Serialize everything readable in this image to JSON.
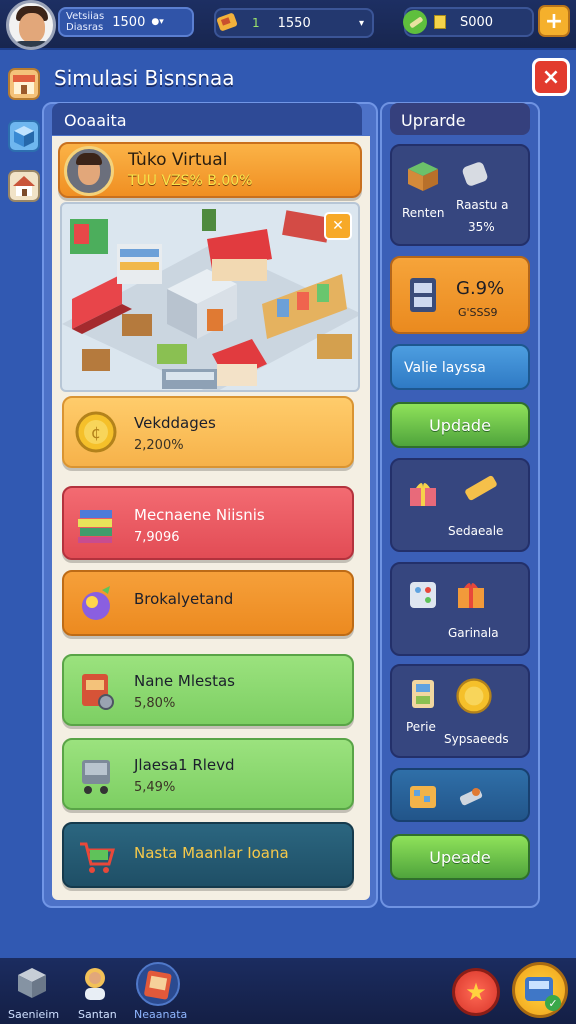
{
  "topbar": {
    "player_name_line1": "Vetsiias",
    "player_name_line2": "Diasras",
    "player_coins": "1500",
    "energy_label": "1",
    "energy_value": "1550",
    "money_value": "S000",
    "add_icon": "plus-icon"
  },
  "header": {
    "title": "Simulasi Bisnsnaa",
    "close": "×"
  },
  "left_panel": {
    "tab_title": "Ooaaita",
    "store": {
      "name": "Tùko Virtual",
      "sub": "TUU VZS% B.00%"
    },
    "items": [
      {
        "title": "Vekddages",
        "value": "2,200%"
      },
      {
        "title": "Mecnaene Niisnis",
        "value": "7,9096"
      },
      {
        "title": "Brokalyetand",
        "value": ""
      },
      {
        "title": "Nane Mlestas",
        "value": "5,80%"
      },
      {
        "title": "Jlaesa1 Rlevd",
        "value": "5,49%"
      },
      {
        "title": "Nasta Maanlar Ioana",
        "value": ""
      }
    ]
  },
  "right_panel": {
    "title": "Uprarde",
    "card1": {
      "left": "Renten",
      "right_line1": "Raastu a",
      "right_line2": "35%"
    },
    "card2": {
      "line1": "G.9%",
      "line2": "G'SSS9"
    },
    "banner": "Valie layssa",
    "button1": "Updade",
    "card3": {
      "label": "Sedaeale"
    },
    "card4": {
      "label": "Garinala"
    },
    "card5": {
      "left": "Perie",
      "right": "Sypsaeeds"
    },
    "button2": "Upeade"
  },
  "bottom_nav": {
    "item1": "Saenieim",
    "item2": "Santan",
    "item3": "Neaanata"
  },
  "colors": {
    "orange": "#f39a2e",
    "gold": "#f8bd52",
    "red": "#e7505c",
    "green": "#7bcf5b",
    "teal": "#235a73",
    "green_button": "#64bd42",
    "blue_bg": "#3159b2"
  }
}
